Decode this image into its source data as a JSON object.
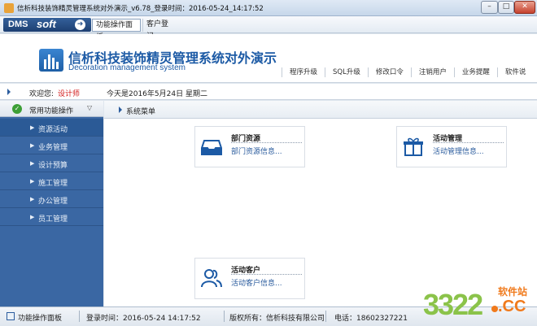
{
  "window": {
    "title": "信析科技装饰精灵管理系统对外演示_v6.78_登录时间：2016-05-24_14:17:52",
    "min_glyph": "–",
    "max_glyph": "□",
    "close_glyph": "✕"
  },
  "menubar": {
    "logo_dms": "DMS",
    "logo_soft": "soft",
    "tabs": [
      "功能操作面板",
      "客户登记"
    ]
  },
  "header": {
    "title": "信析科技装饰精灵管理系统对外演示",
    "subtitle": "Decoration management system",
    "nav": [
      "程序升级",
      "SQL升级",
      "修改口令",
      "注销用户",
      "业务提醒",
      "软件说"
    ]
  },
  "infobar": {
    "welcome": "欢迎您:",
    "user": "设计师",
    "today": "今天是2016年5月24日",
    "weekday": "星期二"
  },
  "sidebar": {
    "group": "常用功能操作",
    "items": [
      "资源活动",
      "业务管理",
      "设计预算",
      "施工管理",
      "办公管理",
      "员工管理"
    ],
    "active_index": 0
  },
  "main": {
    "title": "系统菜单",
    "cards": [
      {
        "icon": "inbox-icon",
        "title": "部门资源",
        "desc": "部门资源信息..."
      },
      {
        "icon": "gift-icon",
        "title": "活动管理",
        "desc": "活动管理信息..."
      },
      {
        "icon": "users-icon",
        "title": "活动客户",
        "desc": "活动客户信息..."
      }
    ]
  },
  "statusbar": {
    "panel": "功能操作面板",
    "login_time": "登录时间：2016-05-24 14:17:52",
    "copyright": "版权所有：信析科技有限公司",
    "phone": "电话：18602327221"
  },
  "watermark": {
    "number": "3322",
    "site": "软件站",
    "domain": ".CC"
  },
  "colors": {
    "accent": "#1c5aa5",
    "sidebar": "#3a67a3",
    "user_red": "#d21b1b"
  }
}
